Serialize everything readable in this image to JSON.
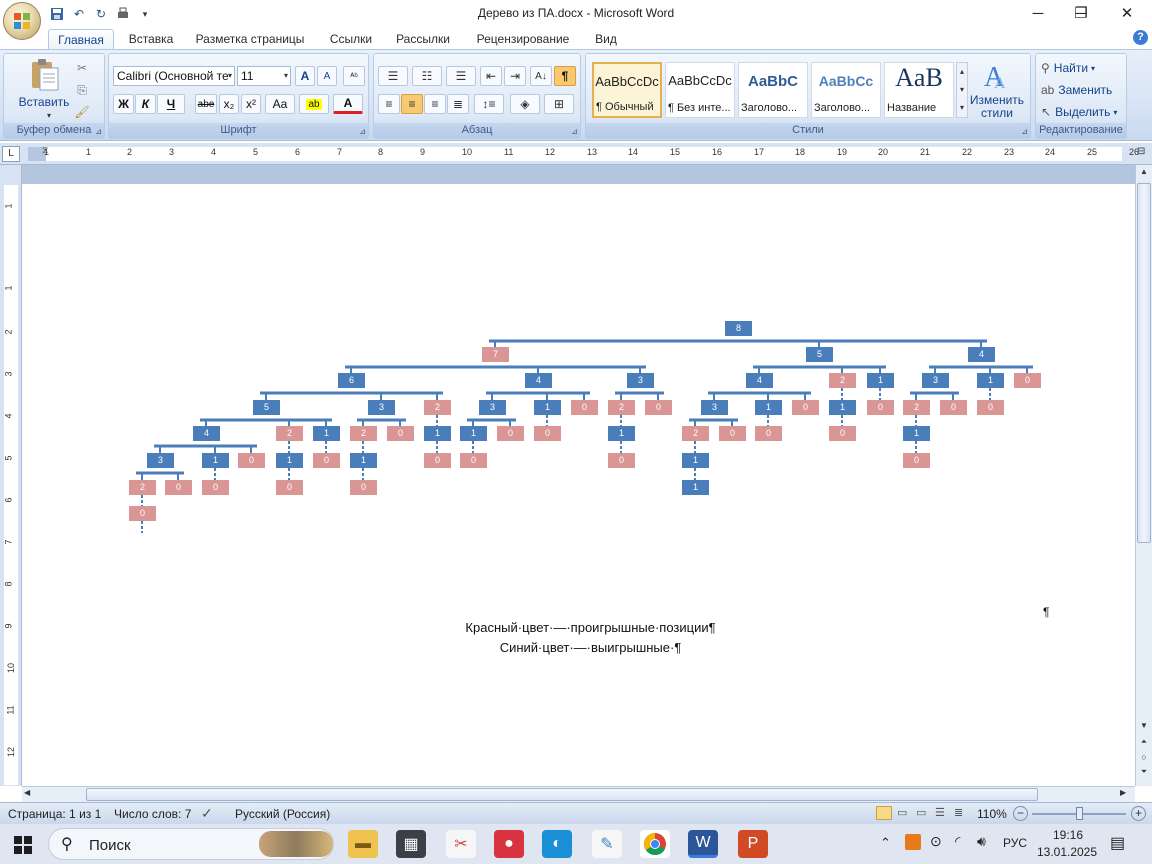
{
  "window": {
    "title": "Дерево из ПА.docx - Microsoft Word",
    "controls": [
      "─",
      "❐",
      "✕"
    ]
  },
  "tabs": [
    "Главная",
    "Вставка",
    "Разметка страницы",
    "Ссылки",
    "Рассылки",
    "Рецензирование",
    "Вид"
  ],
  "ribbon": {
    "clipboard": {
      "title": "Буфер обмена",
      "paste": "Вставить"
    },
    "font": {
      "title": "Шрифт",
      "name": "Calibri (Основной те",
      "size": "11",
      "bold": "Ж",
      "italic": "К",
      "underline": "Ч",
      "strike": "abe",
      "sub": "x₂",
      "sup": "x²",
      "case": "Aa",
      "grow": "A",
      "shrink": "A",
      "font_color": "A"
    },
    "paragraph": {
      "title": "Абзац",
      "show_marks": "¶"
    },
    "styles": {
      "title": "Стили",
      "items": [
        {
          "sample": "AaBbCcDc",
          "name": "¶ Обычный"
        },
        {
          "sample": "AaBbCcDc",
          "name": "¶ Без инте..."
        },
        {
          "sample": "AaBbC",
          "name": "Заголово..."
        },
        {
          "sample": "AaBbCc",
          "name": "Заголово..."
        },
        {
          "sample": "AaB",
          "name": "Название"
        }
      ],
      "change": "Изменить стили"
    },
    "editing": {
      "title": "Редактирование",
      "find": "Найти",
      "replace": "Заменить",
      "select": "Выделить"
    }
  },
  "ruler": {
    "h_labels": [
      "1",
      "1",
      "2",
      "3",
      "4",
      "5",
      "6",
      "7",
      "8",
      "9",
      "10",
      "11",
      "12",
      "13",
      "14",
      "15",
      "16",
      "17",
      "18",
      "19",
      "20",
      "21",
      "22",
      "23",
      "24",
      "25",
      "26"
    ],
    "v_labels": [
      "1",
      "1",
      "2",
      "3",
      "4",
      "5",
      "6",
      "7",
      "8",
      "9",
      "10",
      "11",
      "12"
    ]
  },
  "tree": {
    "nodes": [
      {
        "v": "8",
        "w": true
      },
      {
        "v": "7",
        "w": false
      },
      {
        "v": "5",
        "w": true
      },
      {
        "v": "4",
        "w": true
      },
      {
        "v": "6",
        "w": true
      },
      {
        "v": "4",
        "w": true
      },
      {
        "v": "3",
        "w": true
      },
      {
        "v": "4",
        "w": true
      },
      {
        "v": "2",
        "w": false
      },
      {
        "v": "1",
        "w": true
      },
      {
        "v": "3",
        "w": true
      },
      {
        "v": "1",
        "w": true
      },
      {
        "v": "0",
        "w": false
      },
      {
        "v": "5",
        "w": true
      },
      {
        "v": "3",
        "w": true
      },
      {
        "v": "2",
        "w": false
      },
      {
        "v": "3",
        "w": true
      },
      {
        "v": "1",
        "w": true
      },
      {
        "v": "0",
        "w": false
      },
      {
        "v": "2",
        "w": false
      },
      {
        "v": "0",
        "w": false
      },
      {
        "v": "3",
        "w": true
      },
      {
        "v": "1",
        "w": true
      },
      {
        "v": "0",
        "w": false
      },
      {
        "v": "1",
        "w": true
      },
      {
        "v": "0",
        "w": false
      },
      {
        "v": "2",
        "w": false
      },
      {
        "v": "0",
        "w": false
      },
      {
        "v": "0",
        "w": false
      },
      {
        "v": "4",
        "w": true
      },
      {
        "v": "2",
        "w": false
      },
      {
        "v": "1",
        "w": true
      },
      {
        "v": "2",
        "w": false
      },
      {
        "v": "0",
        "w": false
      },
      {
        "v": "1",
        "w": true
      },
      {
        "v": "1",
        "w": true
      },
      {
        "v": "0",
        "w": false
      },
      {
        "v": "0",
        "w": false
      },
      {
        "v": "1",
        "w": true
      },
      {
        "v": "2",
        "w": false
      },
      {
        "v": "0",
        "w": false
      },
      {
        "v": "0",
        "w": false
      },
      {
        "v": "0",
        "w": false
      },
      {
        "v": "1",
        "w": true
      },
      {
        "v": "3",
        "w": true
      },
      {
        "v": "1",
        "w": true
      },
      {
        "v": "0",
        "w": false
      },
      {
        "v": "1",
        "w": true
      },
      {
        "v": "0",
        "w": false
      },
      {
        "v": "1",
        "w": true
      },
      {
        "v": "0",
        "w": false
      },
      {
        "v": "0",
        "w": false
      },
      {
        "v": "0",
        "w": false
      },
      {
        "v": "1",
        "w": true
      },
      {
        "v": "0",
        "w": false
      },
      {
        "v": "2",
        "w": false
      },
      {
        "v": "0",
        "w": false
      },
      {
        "v": "0",
        "w": false
      },
      {
        "v": "0",
        "w": false
      },
      {
        "v": "0",
        "w": false
      },
      {
        "v": "1",
        "w": true
      },
      {
        "v": "1",
        "w": true
      },
      {
        "v": "0",
        "w": false
      },
      {
        "v": "0",
        "w": false
      },
      {
        "v": "0",
        "w": false
      }
    ]
  },
  "legend": {
    "line1": "Красный·цвет·—·проигрышные·позиции¶",
    "line2": "Синий·цвет·—·выигрышные·¶",
    "mark": "¶"
  },
  "status": {
    "page": "Страница: 1 из 1",
    "words": "Число слов: 7",
    "language": "Русский (Россия)",
    "zoom": "110%"
  },
  "taskbar": {
    "search": "Поиск",
    "lang": "РУС",
    "time": "19:16",
    "date": "13.01.2025"
  },
  "colors": {
    "win": "#4a7ebb",
    "lose": "#d99694"
  }
}
